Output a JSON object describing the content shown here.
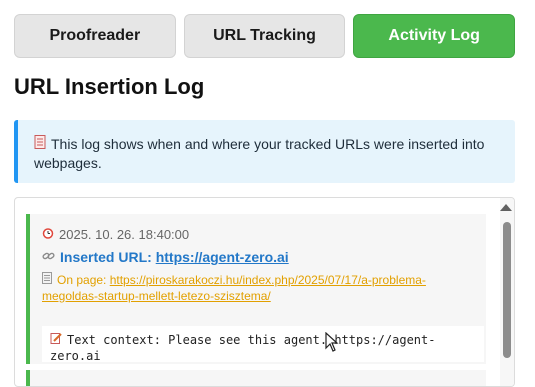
{
  "tabs": [
    {
      "label": "Proofreader",
      "active": false
    },
    {
      "label": "URL Tracking",
      "active": false
    },
    {
      "label": "Activity Log",
      "active": true
    }
  ],
  "page_title": "URL Insertion Log",
  "info": {
    "icon": "page-icon",
    "text": "This log shows when and where your tracked URLs were inserted into webpages."
  },
  "entries": [
    {
      "timestamp": "2025. 10. 26. 18:40:00",
      "inserted_label": "Inserted URL:",
      "inserted_url": "https://agent-zero.ai",
      "page_label": "On page:",
      "page_url": "https://piroskarakoczi.hu/index.php/2025/07/17/a-problema-megoldas-startup-mellett-letezo-szisztema/",
      "context_label": "Text context:",
      "context_text": "Please see this agent. https://agent-zero.ai"
    }
  ],
  "colors": {
    "accent_green": "#4bb84d",
    "info_blue": "#2196f3",
    "link_blue": "#2378c8",
    "page_orange": "#e2a000"
  }
}
